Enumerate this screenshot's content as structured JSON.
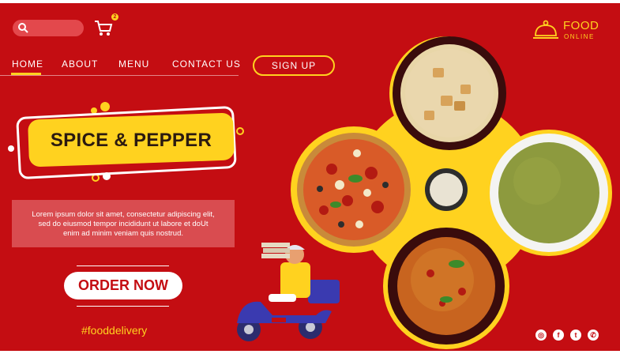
{
  "header": {
    "cart_count": "2",
    "logo_line1": "FOOD",
    "logo_line2": "ONLINE"
  },
  "nav": {
    "home": "HOME",
    "about": "ABOUT",
    "menu": "MENU",
    "contact": "CONTACT US",
    "signup": "SIGN UP"
  },
  "hero": {
    "title": "SPICE & PEPPER",
    "description_lines": [
      "Lorem ipsum dolor sit amet, consectetur adipiscing elit,",
      "sed do eiusmod tempor incididunt ut labore et doUt",
      "enim ad minim veniam quis nostrud."
    ],
    "order_button": "ORDER NOW",
    "hashtag": "#fooddelivery"
  },
  "social": [
    "instagram-icon",
    "facebook-icon",
    "twitter-icon",
    "whatsapp-icon"
  ],
  "colors": {
    "background": "#c40d12",
    "accent": "#ffd21f",
    "text_light": "#ffffff"
  }
}
